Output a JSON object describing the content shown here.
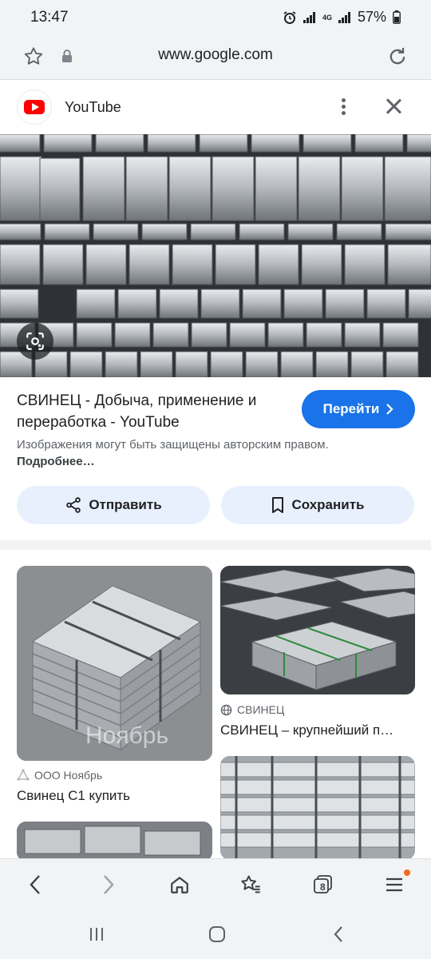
{
  "status_bar": {
    "time": "13:47",
    "network": "4G",
    "battery": "57%"
  },
  "browser": {
    "url": "www.google.com",
    "tab_count": "8"
  },
  "source": {
    "name": "YouTube"
  },
  "result": {
    "title": "СВИНЕЦ - Добыча, применение и переработка - YouTube",
    "go_label": "Перейти",
    "notice": "Изображения могут быть защищены авторским правом.",
    "notice_more": "Подробнее…",
    "share_label": "Отправить",
    "save_label": "Сохранить"
  },
  "related": [
    {
      "source": "ООО Ноябрь",
      "title": "Свинец С1 купить",
      "watermark": "Ноябрь"
    },
    {
      "source": "СВИНЕЦ",
      "title": "СВИНЕЦ – крупнейший п…"
    }
  ],
  "colors": {
    "accent": "#1a73e8",
    "youtube_red": "#ff0000",
    "button_bg": "#e8f0fe",
    "chrome_bg": "#f1f3f4"
  }
}
